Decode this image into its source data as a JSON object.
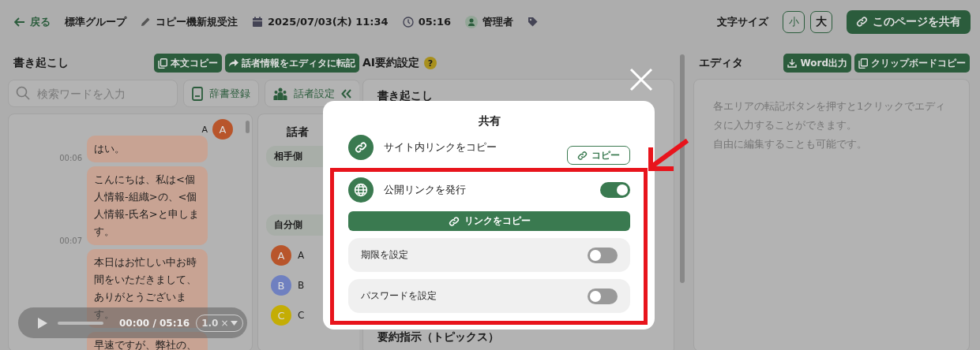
{
  "header": {
    "back": "戻る",
    "group": "標準グループ",
    "title": "コピー機新規受注",
    "datetime": "2025/07/03(木) 11:34",
    "duration": "05:16",
    "user": "管理者",
    "font_size_label": "文字サイズ",
    "font_sizes": [
      "小",
      "大"
    ],
    "share_button": "このページを共有"
  },
  "transcript": {
    "title": "書き起こし",
    "buttons": [
      "本文コピー",
      "話者情報をエディタに転記"
    ],
    "search": {
      "placeholder": "検索ワードを入力"
    },
    "dictionary_button": "辞書登録",
    "speaker_settings_button": "話者設定",
    "speaker_label": "A",
    "avatar": {
      "initial": "A",
      "color": "#b8552b"
    },
    "messages": [
      {
        "time": "00:06",
        "text": "はい。"
      },
      {
        "time": "00:07",
        "text": "こんにちは、私は<個人情報-組織>の、<個人情報-氏名>と申します。"
      },
      {
        "text": "本日はお忙しい中お時間をいただきまして、ありがとうございます。"
      },
      {
        "text": "早速ですが、弊社の、"
      }
    ],
    "player": {
      "time": "00:00 / 05:16",
      "speed": "1.0",
      "speed_unit": "×"
    }
  },
  "speakers": {
    "title": "話者",
    "groups": [
      "相手側",
      "自分側"
    ],
    "items": [
      {
        "initial": "A",
        "name": "A",
        "color": "#b8552b"
      },
      {
        "initial": "B",
        "name": "B",
        "color": "#6f80c0"
      },
      {
        "initial": "C",
        "name": "C",
        "color": "#c4ad05"
      }
    ]
  },
  "ai_settings": {
    "title": "AI要約設定",
    "help": "?",
    "sections": [
      "書き起こし",
      "要約指示（トピックス）"
    ]
  },
  "editor": {
    "title": "エディタ",
    "buttons": [
      "Word出力",
      "クリップボードコピー"
    ],
    "hint_lines": [
      "各エリアの転記ボタンを押すと1クリックでエディタに入力することができます。",
      "自由に編集することも可能です。"
    ]
  },
  "share_dialog": {
    "title": "共有",
    "internal_link": {
      "label": "サイト内リンクをコピー",
      "button": "コピー"
    },
    "public_link": {
      "label": "公開リンクを発行",
      "on": true,
      "button": "リンクをコピー"
    },
    "options": [
      {
        "label": "期限を設定",
        "on": false
      },
      {
        "label": "パスワードを設定",
        "on": false
      }
    ]
  }
}
